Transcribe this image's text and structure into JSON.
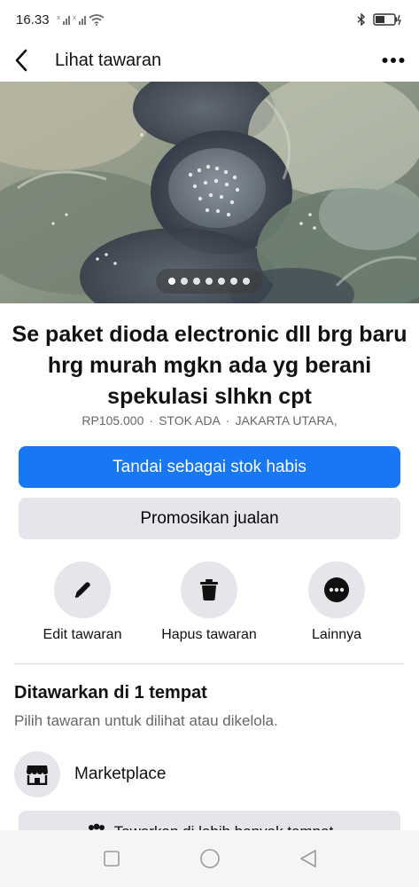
{
  "status": {
    "time": "16.33",
    "icons": [
      "signal-x-icon",
      "signal-x-icon",
      "wifi-icon",
      "bluetooth-icon",
      "battery-icon"
    ]
  },
  "header": {
    "title": "Lihat tawaran",
    "back_icon": "back-arrow-icon",
    "more_icon": "more-horizontal-icon"
  },
  "photo": {
    "page_count": 7,
    "active_index": 0
  },
  "listing": {
    "title": "Se paket dioda electronic dll brg baru hrg murah mgkn ada yg berani spekulasi slhkn cpt",
    "price": "RP105.000",
    "sep1": "·",
    "stock": "STOK ADA",
    "sep2": "·",
    "location": "JAKARTA UTARA,"
  },
  "buttons": {
    "mark_sold": "Tandai sebagai stok habis",
    "promote": "Promosikan jualan"
  },
  "actions": [
    {
      "label": "Edit tawaran",
      "icon": "pencil-icon"
    },
    {
      "label": "Hapus tawaran",
      "icon": "trash-icon"
    },
    {
      "label": "Lainnya",
      "icon": "more-circle-icon"
    }
  ],
  "offered": {
    "title": "Ditawarkan di 1 tempat",
    "subtitle": "Pilih tawaran untuk dilihat atau dikelola.",
    "place": "Marketplace",
    "more_places": "Tawarkan di lebih banyak tempat"
  },
  "colors": {
    "primary": "#1877f2",
    "secondary_bg": "#e4e6eb",
    "muted_text": "#65676b"
  }
}
